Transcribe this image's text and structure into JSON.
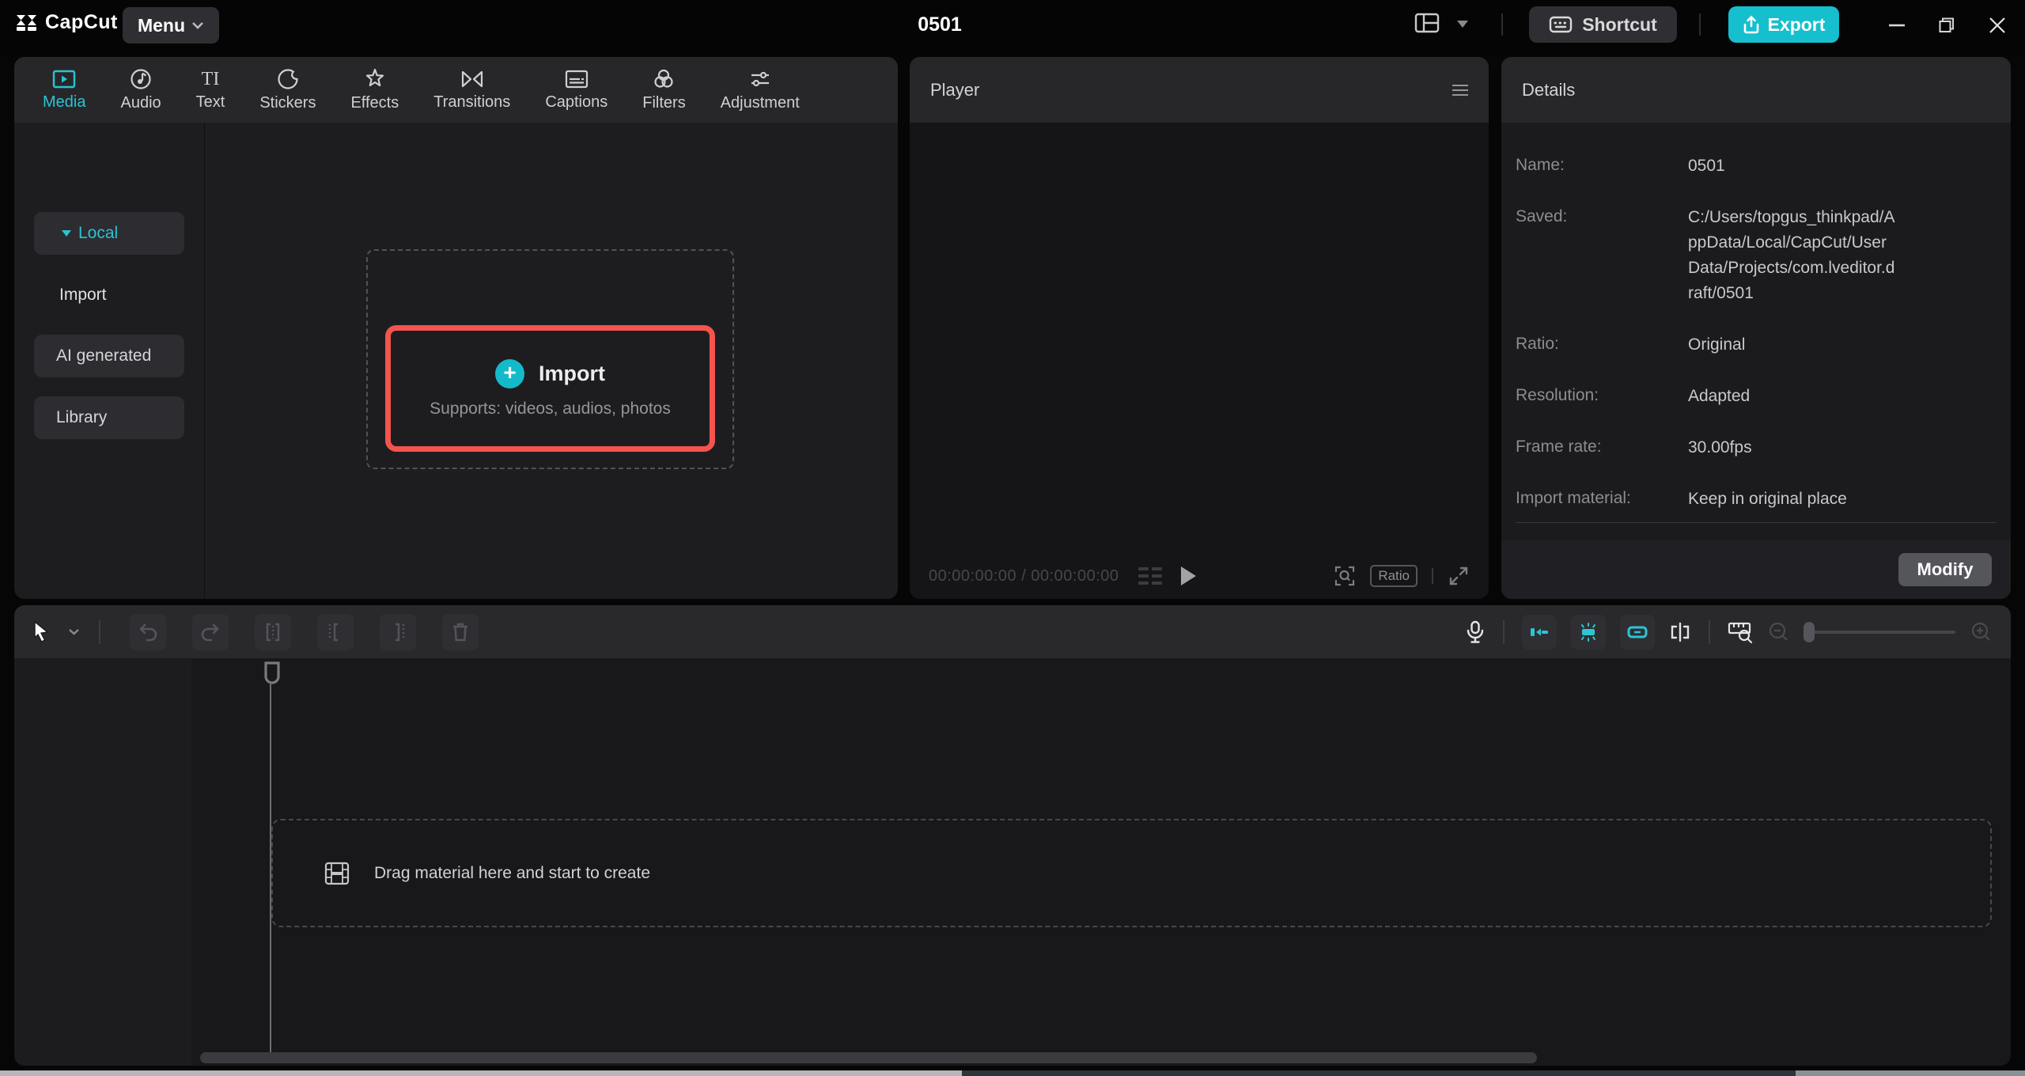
{
  "titlebar": {
    "app_name": "CapCut",
    "menu_label": "Menu",
    "project_title": "0501",
    "shortcut_label": "Shortcut",
    "export_label": "Export"
  },
  "media_panel": {
    "tabs": [
      {
        "label": "Media",
        "selected": true
      },
      {
        "label": "Audio",
        "selected": false
      },
      {
        "label": "Text",
        "selected": false
      },
      {
        "label": "Stickers",
        "selected": false
      },
      {
        "label": "Effects",
        "selected": false
      },
      {
        "label": "Transitions",
        "selected": false
      },
      {
        "label": "Captions",
        "selected": false
      },
      {
        "label": "Filters",
        "selected": false
      },
      {
        "label": "Adjustment",
        "selected": false
      }
    ],
    "text_tab_glyph": "TI",
    "sidebar": {
      "local_label": "Local",
      "import_label": "Import",
      "ai_generated_label": "AI generated",
      "library_label": "Library"
    },
    "import_area": {
      "plus_glyph": "+",
      "import_label": "Import",
      "supports_text": "Supports: videos, audios, photos"
    }
  },
  "player_panel": {
    "header_label": "Player",
    "current_time": "00:00:00:00",
    "time_separator": "/",
    "total_time": "00:00:00:00",
    "ratio_label": "Ratio"
  },
  "details_panel": {
    "header_label": "Details",
    "rows": [
      {
        "label": "Name:",
        "value": "0501"
      },
      {
        "label": "Saved:",
        "value": "C:/Users/topgus_thinkpad/AppData/Local/CapCut/User Data/Projects/com.lveditor.draft/0501"
      },
      {
        "label": "Ratio:",
        "value": "Original"
      },
      {
        "label": "Resolution:",
        "value": "Adapted"
      },
      {
        "label": "Frame rate:",
        "value": "30.00fps"
      },
      {
        "label": "Import material:",
        "value": "Keep in original place"
      }
    ],
    "modify_label": "Modify"
  },
  "timeline": {
    "drop_hint": "Drag material here and start to create"
  },
  "colors": {
    "accent_cyan": "#2ac3d2",
    "highlight_red": "#f4544e",
    "export_button_bg": "#16bfcd"
  }
}
